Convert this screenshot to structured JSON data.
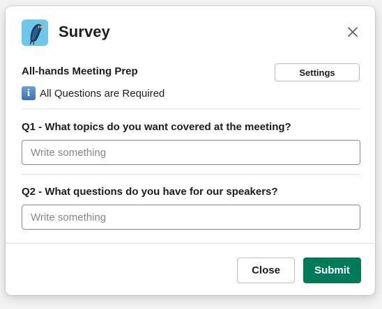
{
  "modal": {
    "title": "Survey",
    "app_icon": "bird-app-icon",
    "close_icon": "close-icon"
  },
  "survey": {
    "name": "All-hands Meeting Prep",
    "settings_label": "Settings",
    "required_icon": "info-icon",
    "required_icon_glyph": "i",
    "required_text": "All Questions are Required"
  },
  "questions": [
    {
      "label": "Q1 - What topics do you want covered at the meeting?",
      "placeholder": "Write something",
      "value": ""
    },
    {
      "label": "Q2 - What questions do you have for our speakers?",
      "placeholder": "Write something",
      "value": ""
    }
  ],
  "footer": {
    "close_label": "Close",
    "submit_label": "Submit"
  },
  "colors": {
    "submit_bg": "#007a5a",
    "app_icon_bg": "#6ec6e8",
    "info_icon_bg": "#3b73b8"
  }
}
